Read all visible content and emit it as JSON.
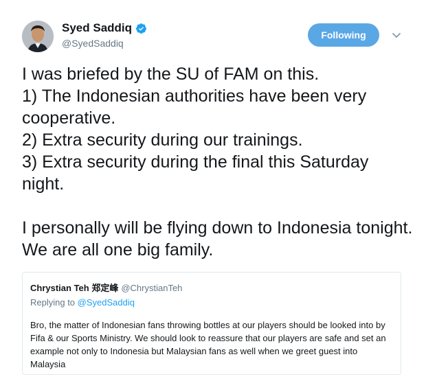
{
  "tweet": {
    "author": {
      "name": "Syed Saddiq",
      "handle": "@SyedSaddiq",
      "verified": true
    },
    "follow_label": "Following",
    "text_lines": [
      "I was briefed by the SU of FAM on this.",
      "1) The Indonesian authorities have been very cooperative.",
      "2) Extra security during our trainings.",
      "3) Extra security during the final this Saturday night.",
      "I personally will be flying down to Indonesia tonight. We are all one big family."
    ]
  },
  "quoted_tweet": {
    "name": "Chrystian Teh 郑定峰",
    "handle": "@ChrystianTeh",
    "replying_prefix": "Replying to",
    "replying_to": "@SyedSaddiq",
    "text": "Bro, the matter of Indonesian fans throwing bottles at our players should be looked into by Fifa & our Sports Ministry. We should look to reassure that our players are safe and set an example not only to Indonesia but Malaysian fans as well when we greet guest into Malaysia"
  },
  "colors": {
    "follow_button": "#5aa7e6",
    "verified_badge": "#1da1f2",
    "secondary_text": "#657786",
    "link": "#1da1f2"
  },
  "icons": {
    "verified": "verified-badge-icon",
    "caret": "chevron-down-icon"
  }
}
